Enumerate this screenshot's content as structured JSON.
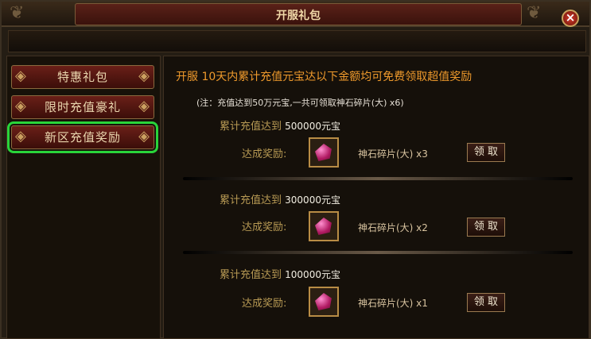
{
  "window": {
    "title": "开服礼包",
    "close_label": "×"
  },
  "sidebar": {
    "tabs": [
      {
        "label": "特惠礼包",
        "active": false
      },
      {
        "label": "限时充值豪礼",
        "active": false
      },
      {
        "label": "新区充值奖励",
        "active": true
      }
    ]
  },
  "main": {
    "intro": "开服 10天内累计充值元宝达以下金额均可免费领取超值奖励",
    "note": "(注：充值达到50万元宝,一共可领取神石碎片(大) x6)",
    "tiers": [
      {
        "title_prefix": "累计充值达到",
        "amount": "500000元宝",
        "reward_label": "达成奖励:",
        "item": "神石碎片(大) x3",
        "claim_label": "领 取"
      },
      {
        "title_prefix": "累计充值达到",
        "amount": "300000元宝",
        "reward_label": "达成奖励:",
        "item": "神石碎片(大) x2",
        "claim_label": "领 取"
      },
      {
        "title_prefix": "累计充值达到",
        "amount": "100000元宝",
        "reward_label": "达成奖励:",
        "item": "神石碎片(大) x1",
        "claim_label": "领 取"
      }
    ]
  },
  "colors": {
    "active_outline": "#29d43a",
    "intro_text": "#ef9a2c",
    "label_gold": "#b89a54"
  },
  "icons": {
    "reward_item": "gem-icon",
    "close": "close-icon"
  }
}
